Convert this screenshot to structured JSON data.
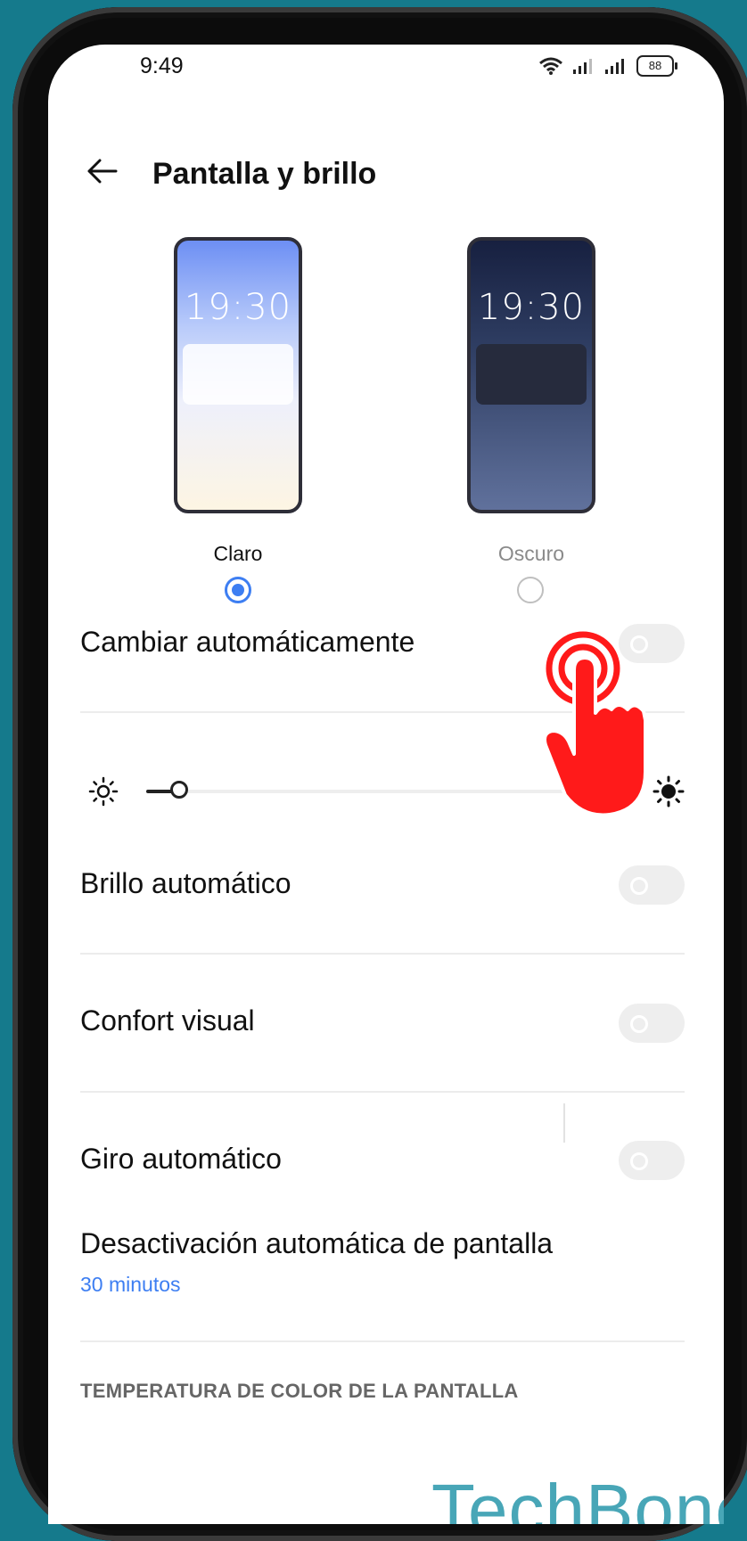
{
  "status_bar": {
    "time": "9:49",
    "battery": "88"
  },
  "header": {
    "title": "Pantalla y brillo"
  },
  "theme": {
    "light": {
      "preview_time": "19:30",
      "label": "Claro",
      "selected": true
    },
    "dark": {
      "preview_time": "19:30",
      "label": "Oscuro",
      "selected": false
    }
  },
  "settings": {
    "auto_switch": {
      "label": "Cambiar automáticamente",
      "enabled": false
    },
    "brightness": {
      "level": 0.07
    },
    "auto_brightness": {
      "label": "Brillo automático",
      "enabled": false
    },
    "eye_comfort": {
      "label": "Confort visual",
      "enabled": false
    },
    "auto_rotate": {
      "label": "Giro automático",
      "enabled": false
    },
    "screen_timeout": {
      "label": "Desactivación automática de pantalla",
      "value": "30 minutos"
    }
  },
  "section": {
    "color_temperature_header": "TEMPERATURA DE COLOR DE LA PANTALLA"
  },
  "watermark": "TechBone",
  "colors": {
    "accent": "#3d7ef2",
    "background": "#157a8c",
    "tap_indicator": "#ff1a1a"
  }
}
